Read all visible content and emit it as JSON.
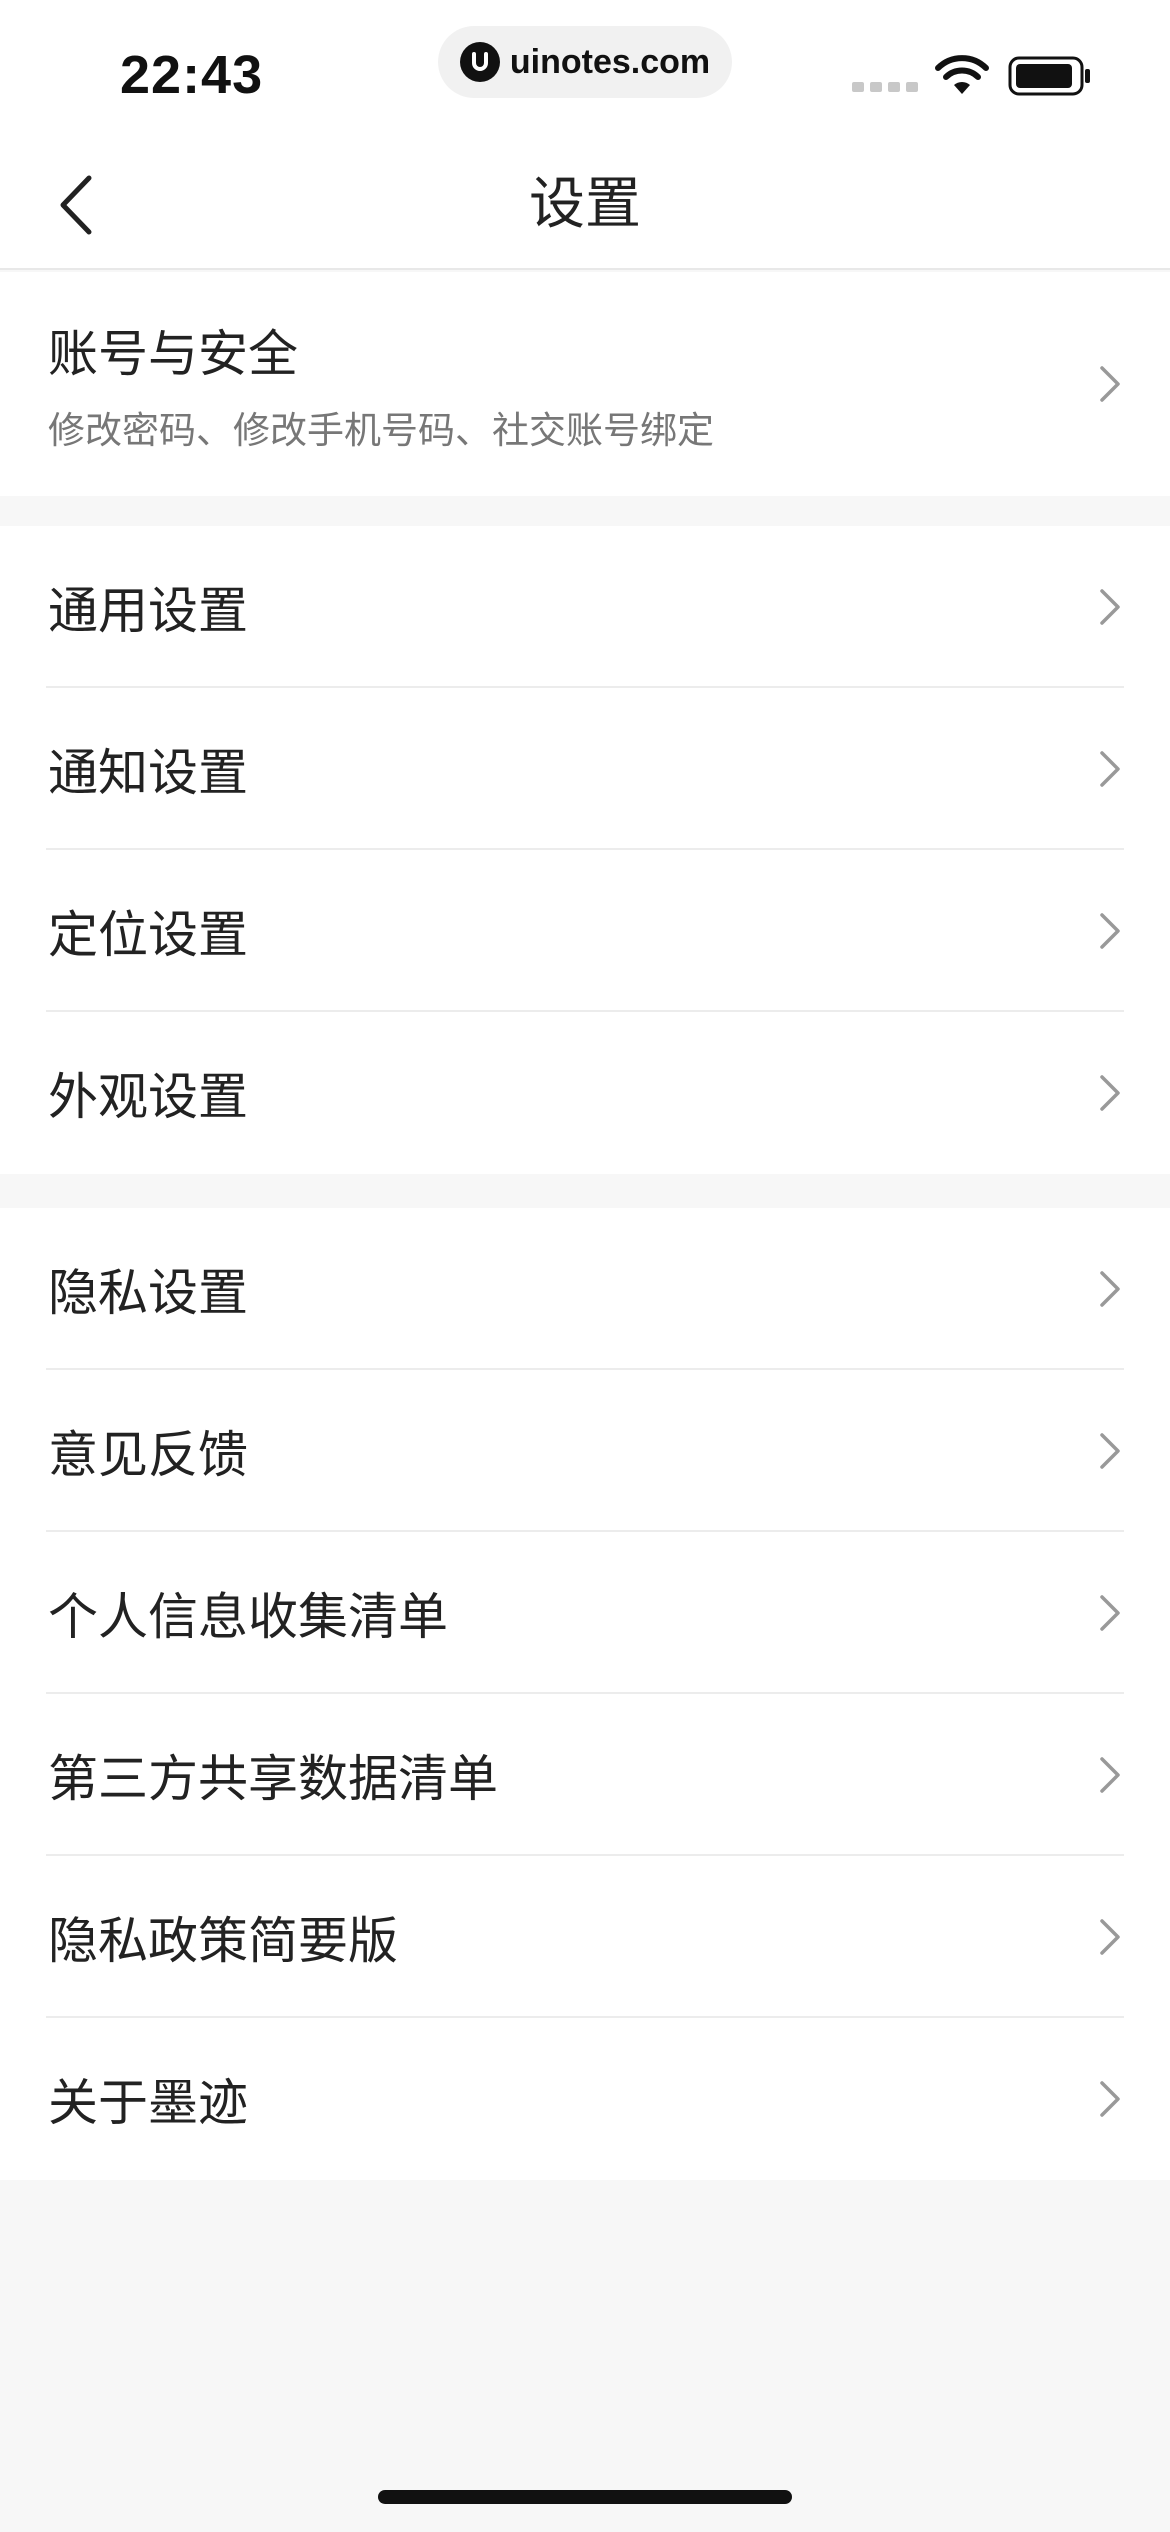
{
  "status_bar": {
    "time": "22:43",
    "url": "uinotes.com"
  },
  "nav": {
    "title": "设置",
    "back_icon": "chevron-left-icon"
  },
  "account": {
    "title": "账号与安全",
    "subtitle": "修改密码、修改手机号码、社交账号绑定"
  },
  "group_general": [
    {
      "label": "通用设置"
    },
    {
      "label": "通知设置"
    },
    {
      "label": "定位设置"
    },
    {
      "label": "外观设置"
    }
  ],
  "group_privacy": [
    {
      "label": "隐私设置"
    },
    {
      "label": "意见反馈"
    },
    {
      "label": "个人信息收集清单"
    },
    {
      "label": "第三方共享数据清单"
    },
    {
      "label": "隐私政策简要版"
    },
    {
      "label": "关于墨迹"
    }
  ],
  "colors": {
    "background": "#f7f7f7",
    "card": "#ffffff",
    "text": "#222222",
    "subtext": "#777777",
    "divider": "#ececec",
    "chevron": "#999999"
  }
}
